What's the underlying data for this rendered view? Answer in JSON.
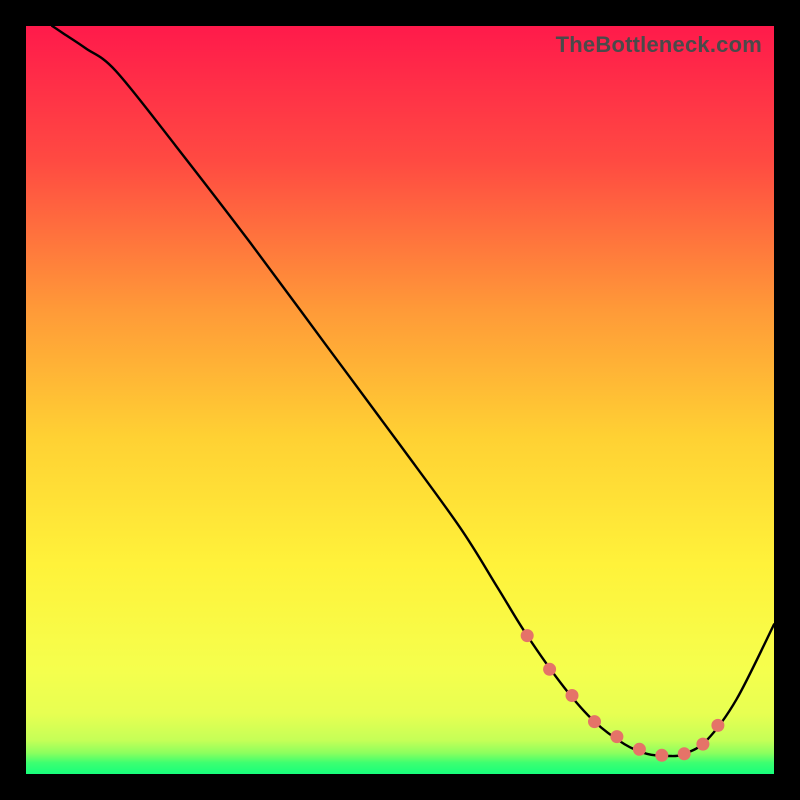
{
  "watermark": "TheBottleneck.com",
  "colors": {
    "bg_black": "#000000",
    "curve": "#000000",
    "dot_fill": "#e57368",
    "grad_top": "#ff1a4b",
    "grad_q1": "#ff6a3c",
    "grad_mid": "#ffcf33",
    "grad_q3": "#f5ff4d",
    "grad_near_bottom": "#d8ff55",
    "grad_bottom_band": "#2dff74"
  },
  "chart_data": {
    "type": "line",
    "title": "",
    "xlabel": "",
    "ylabel": "",
    "xlim": [
      0,
      100
    ],
    "ylim": [
      0,
      100
    ],
    "grid": false,
    "legend": false,
    "note": "No axes or tick labels are rendered; values are estimated from pixel positions within the 748×748 plot area. x,y in percent of that area with (0,0) at bottom-left.",
    "series": [
      {
        "name": "bottleneck-curve",
        "x": [
          3.5,
          5.0,
          8.0,
          12.0,
          20.0,
          30.0,
          40.0,
          50.0,
          58.0,
          63.0,
          67.0,
          72.0,
          76.0,
          80.0,
          83.0,
          86.0,
          88.0,
          91.0,
          95.0,
          100.0
        ],
        "y": [
          100.0,
          99.0,
          97.0,
          94.0,
          84.0,
          71.0,
          57.5,
          44.0,
          33.0,
          25.0,
          18.5,
          11.5,
          7.0,
          4.0,
          2.7,
          2.4,
          2.7,
          4.5,
          10.0,
          20.0
        ]
      }
    ],
    "markers": {
      "name": "highlight-dots",
      "x": [
        67.0,
        70.0,
        73.0,
        76.0,
        79.0,
        82.0,
        85.0,
        88.0,
        90.5,
        92.5
      ],
      "y": [
        18.5,
        14.0,
        10.5,
        7.0,
        5.0,
        3.3,
        2.5,
        2.7,
        4.0,
        6.5
      ]
    }
  }
}
